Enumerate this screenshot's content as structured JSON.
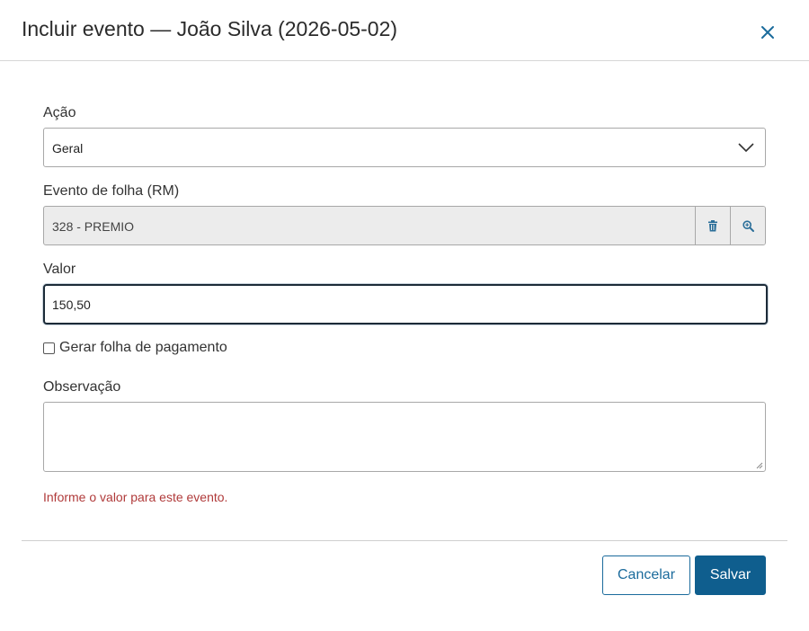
{
  "dialog": {
    "title": "Incluir evento — João Silva (2026-05-02)",
    "close_icon": "close-icon"
  },
  "form": {
    "acao": {
      "label": "Ação",
      "value": "Geral",
      "icon": "chevron-down-icon"
    },
    "evento": {
      "label": "Evento de folha (RM)",
      "value": "328 - PREMIO",
      "delete_icon": "trash-icon",
      "search_icon": "zoom-in-icon"
    },
    "valor": {
      "label": "Valor",
      "value": "150,50"
    },
    "gerar_folha": {
      "label": "Gerar folha de pagamento",
      "checked": false
    },
    "observacao": {
      "label": "Observação",
      "value": ""
    },
    "error": "Informe o valor para este evento."
  },
  "footer": {
    "cancel_label": "Cancelar",
    "save_label": "Salvar"
  },
  "colors": {
    "accent": "#0f5e8e",
    "error": "#b03a3a",
    "readonly_bg": "#ececec"
  }
}
